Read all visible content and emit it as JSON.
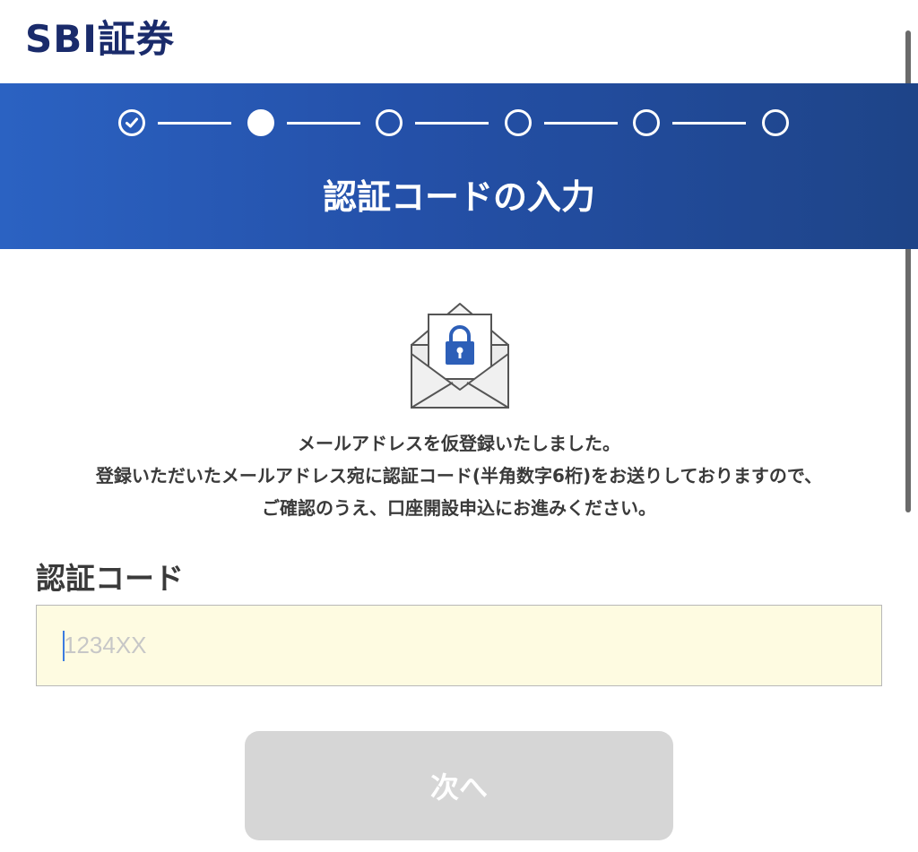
{
  "header": {
    "logo_text": "SBI証券"
  },
  "progress": {
    "total_steps": 6,
    "current_step": 2,
    "completed_steps": 1
  },
  "page_title": "認証コードの入力",
  "message": {
    "line1": "メールアドレスを仮登録いたしました。",
    "line2": "登録いただいたメールアドレス宛に認証コード(半角数字6桁)をお送りしておりますので、",
    "line3": "ご確認のうえ、口座開設申込にお進みください。"
  },
  "form": {
    "code_label": "認証コード",
    "code_placeholder": "1234XX",
    "code_value": ""
  },
  "next_button": {
    "label": "次へ",
    "enabled": false
  },
  "colors": {
    "brand_navy": "#1a2b6b",
    "banner_blue": "#2450a8",
    "input_bg": "#fefbe1",
    "button_disabled": "#d6d6d6",
    "lock_blue": "#2d5fb8"
  }
}
